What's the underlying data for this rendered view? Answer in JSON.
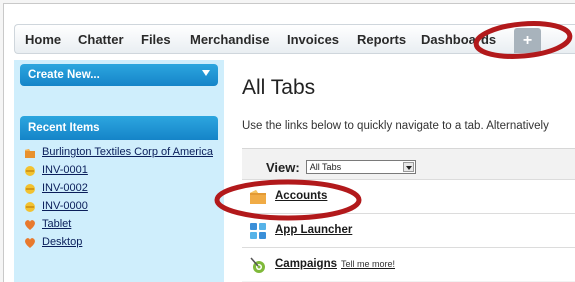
{
  "tabs": [
    "Home",
    "Chatter",
    "Files",
    "Merchandise",
    "Invoices",
    "Reports",
    "Dashboards"
  ],
  "plus_tab_label": "+",
  "sidebar": {
    "create_new_label": "Create New...",
    "recent_items_header": "Recent Items",
    "recent_items": [
      {
        "label": "Burlington Textiles Corp of America",
        "icon": "account-icon"
      },
      {
        "label": "INV-0001",
        "icon": "invoice-icon"
      },
      {
        "label": "INV-0002",
        "icon": "invoice-icon"
      },
      {
        "label": "INV-0000",
        "icon": "invoice-icon"
      },
      {
        "label": "Tablet",
        "icon": "merchandise-icon"
      },
      {
        "label": "Desktop",
        "icon": "merchandise-icon"
      }
    ]
  },
  "main": {
    "title": "All Tabs",
    "instructions": "Use the links below to quickly navigate to a tab. Alternatively",
    "view_label": "View:",
    "view_value": "All Tabs",
    "rows": [
      {
        "label": "Accounts",
        "extra": "",
        "icon": "accounts-folder-icon"
      },
      {
        "label": "App Launcher",
        "extra": "",
        "icon": "app-launcher-icon"
      },
      {
        "label": "Campaigns",
        "extra": "Tell me more!",
        "icon": "campaigns-icon"
      }
    ]
  },
  "colors": {
    "accent_blue": "#1e90d6",
    "sidebar_bg": "#cfeefc",
    "highlight_ellipse": "#b2191b"
  }
}
